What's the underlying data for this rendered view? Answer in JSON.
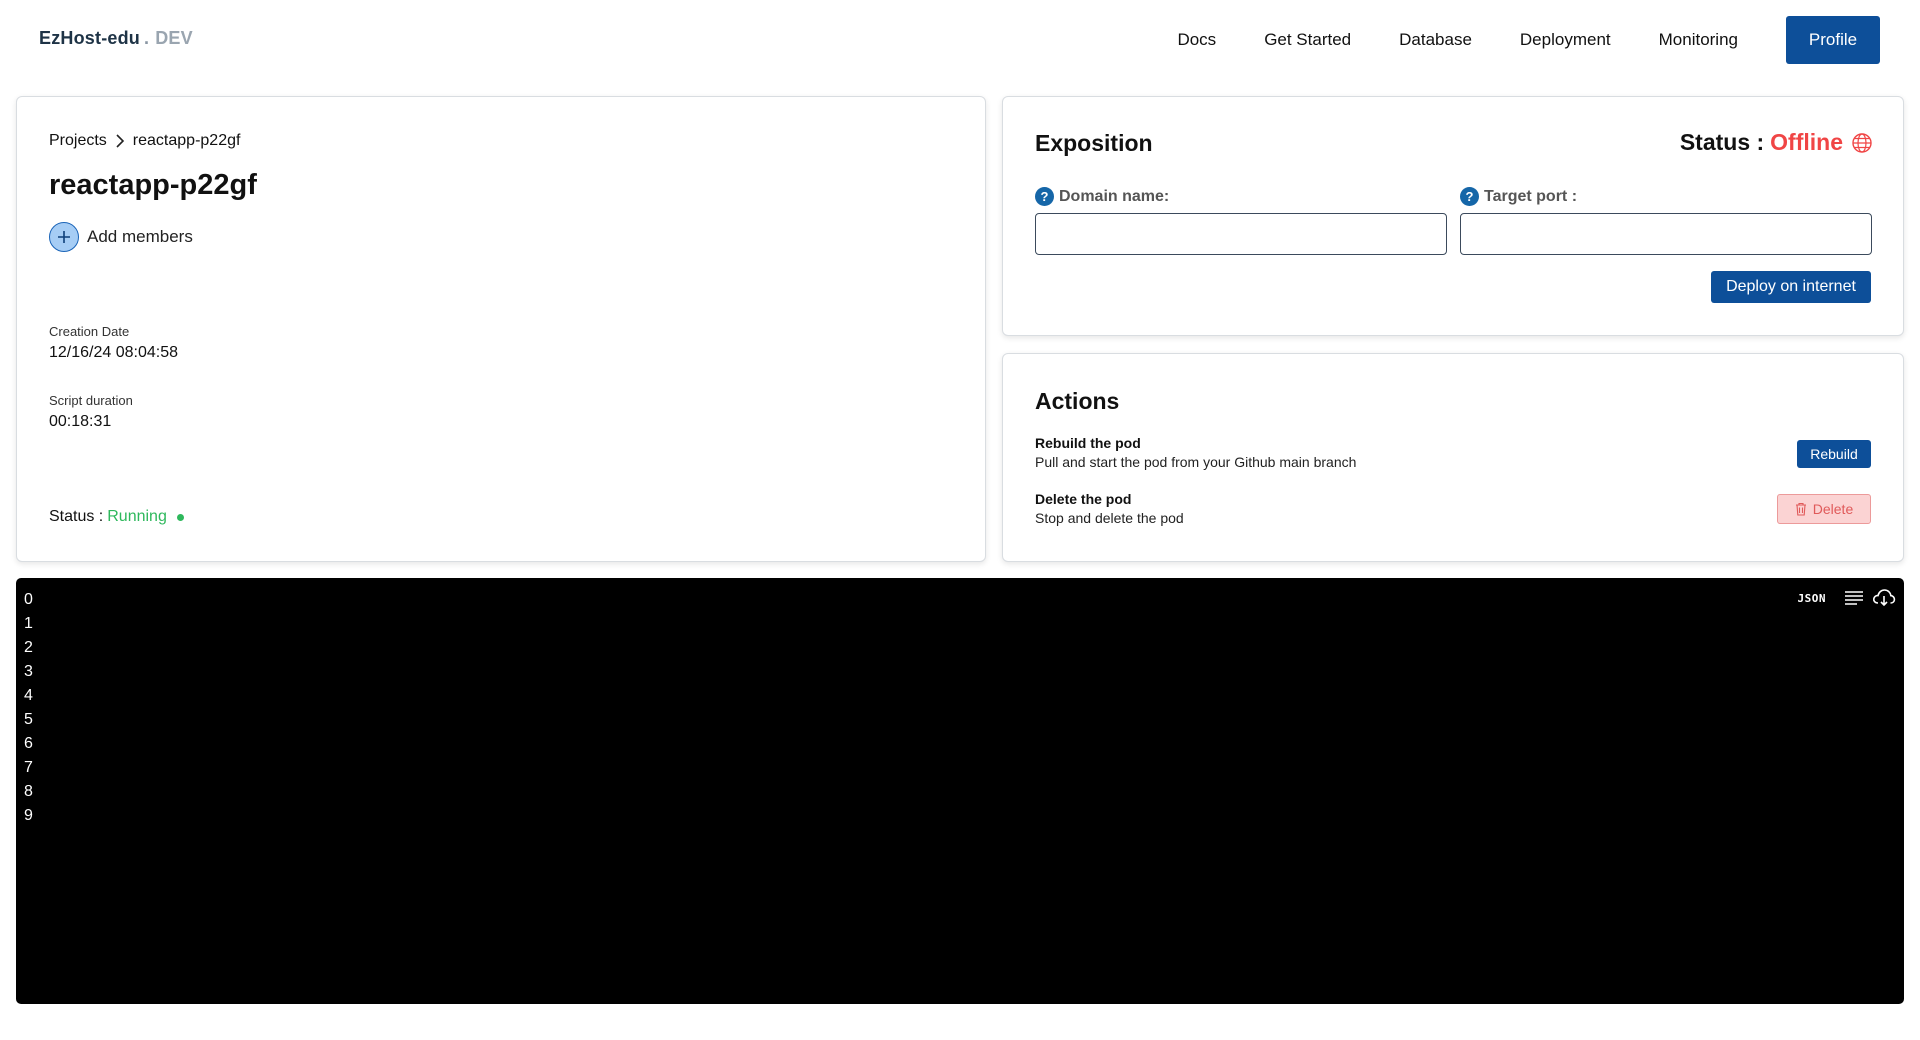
{
  "navbar": {
    "brand": "EzHost-edu",
    "brand_dot": ".",
    "brand_env": "DEV",
    "links": [
      "Docs",
      "Get Started",
      "Database",
      "Deployment",
      "Monitoring"
    ],
    "profile_label": "Profile"
  },
  "project": {
    "breadcrumb_root": "Projects",
    "breadcrumb_current": "reactapp-p22gf",
    "title": "reactapp-p22gf",
    "add_members_label": "Add members",
    "creation_date_label": "Creation Date",
    "creation_date_value": "12/16/24 08:04:58",
    "script_duration_label": "Script duration",
    "script_duration_value": "00:18:31",
    "status_label": "Status :",
    "status_value": "Running"
  },
  "exposition": {
    "title": "Exposition",
    "status_label": "Status :",
    "status_value": "Offline",
    "domain_label": "Domain name:",
    "domain_value": "",
    "port_label": "Target port :",
    "port_value": "",
    "deploy_label": "Deploy on internet"
  },
  "actions": {
    "title": "Actions",
    "rebuild_title": "Rebuild the pod",
    "rebuild_desc": "Pull and start the pod from your Github main branch",
    "rebuild_label": "Rebuild",
    "delete_title": "Delete the pod",
    "delete_desc": "Stop and delete the pod",
    "delete_label": "Delete"
  },
  "terminal": {
    "line_numbers": [
      "0",
      "1",
      "2",
      "3",
      "4",
      "5",
      "6",
      "7",
      "8",
      "9"
    ],
    "json_label": "JSON"
  },
  "colors": {
    "primary": "#0d4f99",
    "running": "#2eb85c",
    "offline": "#f04545",
    "terminal_bg": "#000000"
  }
}
